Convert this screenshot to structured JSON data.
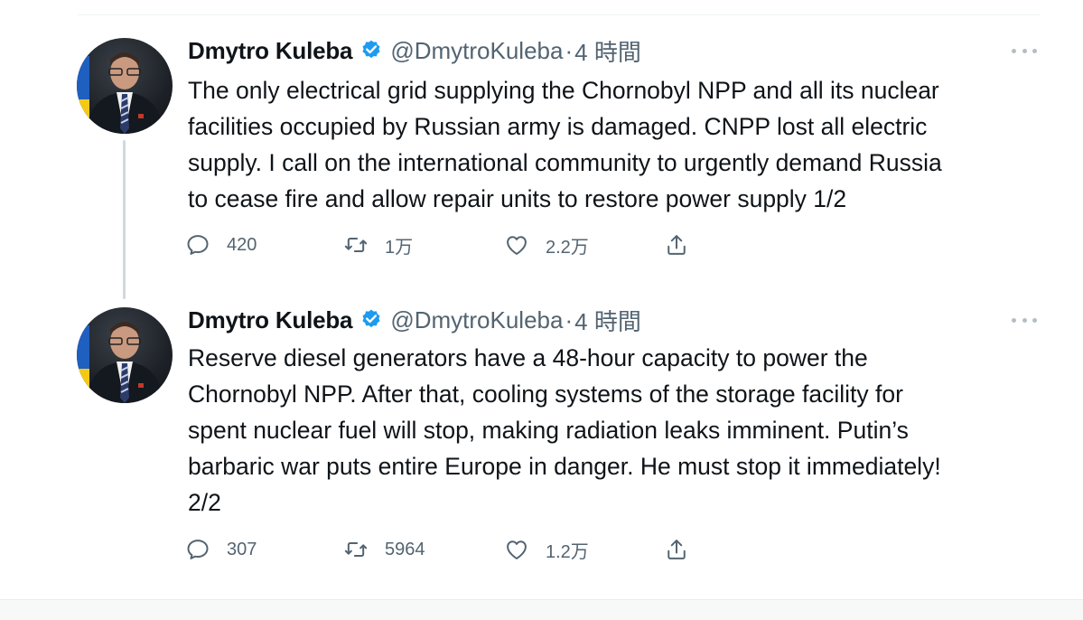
{
  "tweets": [
    {
      "author": {
        "name": "Dmytro Kuleba",
        "handle": "@DmytroKuleba",
        "verified": true
      },
      "separator": "·",
      "time": "4 時間",
      "text": "The only electrical grid supplying the Chornobyl NPP and all its nuclear\nfacilities occupied by Russian army is damaged. CNPP lost all electric\nsupply. I call on the international community to urgently demand Russia\nto cease fire and allow repair units to restore power supply 1/2",
      "stats": {
        "replies": "420",
        "retweets": "1万",
        "likes": "2.2万"
      }
    },
    {
      "author": {
        "name": "Dmytro Kuleba",
        "handle": "@DmytroKuleba",
        "verified": true
      },
      "separator": "·",
      "time": "4 時間",
      "text": "Reserve diesel generators have a 48-hour capacity to power the\nChornobyl NPP. After that, cooling systems of the storage facility for\nspent nuclear fuel will stop, making radiation leaks imminent. Putin’s\nbarbaric war puts entire Europe in danger. He must stop it immediately!\n2/2",
      "stats": {
        "replies": "307",
        "retweets": "5964",
        "likes": "1.2万"
      }
    }
  ],
  "icons": {
    "verified": "verified-badge-icon",
    "more": "more-icon",
    "reply": "reply-icon",
    "retweet": "retweet-icon",
    "like": "like-icon",
    "share": "share-icon"
  },
  "colors": {
    "verified": "#1d9bf0",
    "secondary_text": "#536471",
    "icon": "#536471",
    "thread_line": "#cfd9de",
    "avatar_flag_blue": "#1f5fbf",
    "avatar_flag_yellow": "#f3c916"
  }
}
